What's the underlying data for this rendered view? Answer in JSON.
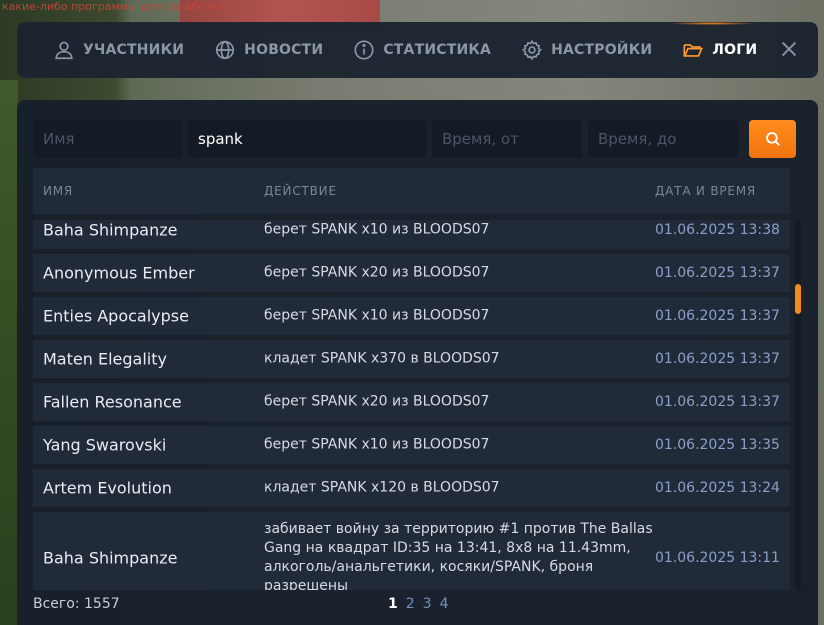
{
  "background": {
    "overlay_text": "какие-либо программы для заработка"
  },
  "nav": {
    "items": [
      {
        "label": "УЧАСТНИКИ",
        "icon": "user-icon",
        "active": false
      },
      {
        "label": "НОВОСТИ",
        "icon": "globe-icon",
        "active": false
      },
      {
        "label": "СТАТИСТИКА",
        "icon": "info-icon",
        "active": false
      },
      {
        "label": "НАСТРОЙКИ",
        "icon": "gear-icon",
        "active": false
      },
      {
        "label": "ЛОГИ",
        "icon": "folder-icon",
        "active": true
      }
    ],
    "close_icon": "close-icon",
    "accent_color": "#ff8a1a"
  },
  "filters": {
    "name": {
      "value": "",
      "placeholder": "Имя"
    },
    "query": {
      "value": "spank",
      "placeholder": ""
    },
    "time_from": {
      "value": "",
      "placeholder": "Время, от"
    },
    "time_to": {
      "value": "",
      "placeholder": "Время, до"
    },
    "search_icon": "search-icon"
  },
  "table": {
    "headers": {
      "name": "ИМЯ",
      "action": "ДЕЙСТВИЕ",
      "date": "ДАТА И ВРЕМЯ"
    },
    "rows": [
      {
        "name": "Baha Shimpanze",
        "action": "берет SPANK x10 из BLOODS07",
        "date": "01.06.2025 13:38"
      },
      {
        "name": "Anonymous Ember",
        "action": "берет SPANK x20 из BLOODS07",
        "date": "01.06.2025 13:37"
      },
      {
        "name": "Enties Apocalypse",
        "action": "берет SPANK x10 из BLOODS07",
        "date": "01.06.2025 13:37"
      },
      {
        "name": "Maten Elegality",
        "action": "кладет SPANK x370 в BLOODS07",
        "date": "01.06.2025 13:37"
      },
      {
        "name": "Fallen Resonance",
        "action": "берет SPANK x20 из BLOODS07",
        "date": "01.06.2025 13:37"
      },
      {
        "name": "Yang Swarovski",
        "action": "берет SPANK x10 из BLOODS07",
        "date": "01.06.2025 13:35"
      },
      {
        "name": "Artem Evolution",
        "action": "кладет SPANK x120 в BLOODS07",
        "date": "01.06.2025 13:24"
      },
      {
        "name": "Baha Shimpanze",
        "action": "забивает войну за территорию #1 против The Ballas Gang на квадрат ID:35 на 13:41, 8x8 на 11.43mm, алкоголь/анальгетики, косяки/SPANK, броня разрешены",
        "date": "01.06.2025 13:11"
      }
    ]
  },
  "footer": {
    "total": "Всего: 1557",
    "pages": [
      "1",
      "2",
      "3",
      "4"
    ],
    "current_page": "1"
  }
}
